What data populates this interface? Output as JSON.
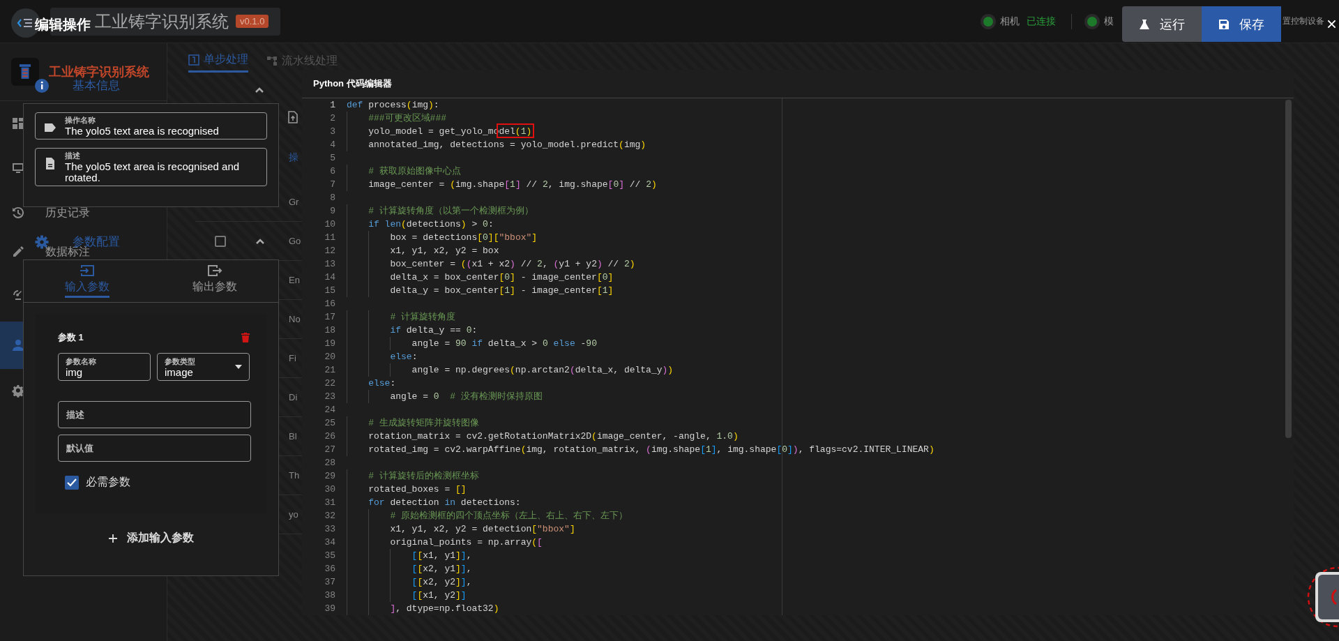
{
  "app": {
    "title": "工业铸字识别系统",
    "version": "v0.1.0"
  },
  "status_items": [
    {
      "label": "相机",
      "value": "已连接",
      "connected": true
    },
    {
      "label": "模",
      "connected": true
    }
  ],
  "partial_label": "置控制设备",
  "sidebar": {
    "brand": "工业铸字识别系统",
    "items": [
      {
        "selected": false
      },
      {
        "selected": false
      },
      {
        "label": "历史记录",
        "selected": false
      },
      {
        "label": "数据标注",
        "selected": false
      },
      {
        "selected": false
      },
      {
        "selected": true
      },
      {
        "selected": false
      }
    ]
  },
  "middle": {
    "tabs": [
      {
        "label": "单步处理",
        "selected": true
      },
      {
        "label": "流水线处理",
        "selected": false
      }
    ],
    "header_expanded": true,
    "section_label": "操",
    "operations": [
      {
        "label": "Gr",
        "kind": "item"
      },
      {
        "label": "Go",
        "kind": "group",
        "checked": false,
        "expanded": true
      },
      {
        "label": "En",
        "kind": "item"
      },
      {
        "label": "No",
        "kind": "item"
      },
      {
        "label": "Fi",
        "kind": "item"
      },
      {
        "label": "Di",
        "kind": "item"
      },
      {
        "label": "Bl",
        "kind": "item"
      },
      {
        "label": "Th",
        "kind": "item"
      },
      {
        "label": "yo",
        "kind": "item"
      }
    ]
  },
  "dialog": {
    "title": "编辑操作",
    "actions": [
      {
        "label": "运行",
        "kind": "run"
      },
      {
        "label": "保存",
        "kind": "save"
      }
    ],
    "basic_info": {
      "heading": "基本信息",
      "fields": [
        {
          "label": "操作名称",
          "value": "The yolo5 text area is recognised"
        },
        {
          "label": "描述",
          "value": "The yolo5 text area is recognised and rotated."
        }
      ]
    },
    "param_config": {
      "heading": "参数配置",
      "tabs": [
        {
          "label": "输入参数",
          "selected": true
        },
        {
          "label": "输出参数",
          "selected": false
        }
      ],
      "params": [
        {
          "title": "参数 1",
          "name_label": "参数名称",
          "name": "img",
          "type_label": "参数类型",
          "type": "image",
          "description_placeholder": "描述",
          "default_placeholder": "默认值",
          "required_label": "必需参数",
          "required": true
        }
      ],
      "add_button": "添加输入参数"
    },
    "editor": {
      "title": "Python 代码编辑器",
      "lines": [
        {
          "number": "1",
          "segments": [
            {
              "kind": "keyword",
              "text": "def"
            },
            {
              "kind": "code",
              "text": " process(img):"
            }
          ]
        },
        {
          "number": "2",
          "segments": [
            {
              "kind": "comment",
              "text": "    ###可更改区域###"
            }
          ]
        },
        {
          "number": "3",
          "segments": [
            {
              "kind": "code",
              "text": "    yolo_model = get_yolo_mo"
            },
            {
              "kind": "code",
              "text": "del(1)",
              "marked": true
            }
          ]
        },
        {
          "number": "4",
          "segments": [
            {
              "kind": "code",
              "text": "    annotated_img, detections = yolo_model.predict(img)"
            }
          ]
        },
        {
          "number": "5"
        },
        {
          "number": "6",
          "segments": [
            {
              "kind": "comment",
              "text": "    # 获取原始图像中心点"
            }
          ]
        },
        {
          "number": "7",
          "segments": [
            {
              "kind": "code",
              "text": "    image_center = (img.shape[1] // 2, img.shape[0] // 2)"
            }
          ]
        },
        {
          "number": "8"
        },
        {
          "number": "9",
          "segments": [
            {
              "kind": "comment",
              "text": "    # 计算旋转角度（以第一个检测框为例）"
            }
          ]
        },
        {
          "number": "10",
          "segments": [
            {
              "kind": "keyword",
              "text": "    if "
            },
            {
              "kind": "keyword",
              "text": "len"
            },
            {
              "kind": "code",
              "text": "(detections) > 0:"
            }
          ]
        },
        {
          "number": "11",
          "segments": [
            {
              "kind": "code",
              "text": "        box = detections[0]["
            },
            {
              "kind": "string",
              "text": "\"bbox\""
            },
            {
              "kind": "code",
              "text": "]"
            }
          ]
        },
        {
          "number": "12",
          "segments": [
            {
              "kind": "code",
              "text": "        x1, y1, x2, y2 = box"
            }
          ]
        },
        {
          "number": "13",
          "segments": [
            {
              "kind": "code",
              "text": "        box_center = ((x1 + x2) // 2, (y1 + y2) // 2)"
            }
          ]
        },
        {
          "number": "14",
          "segments": [
            {
              "kind": "code",
              "text": "        delta_x = box_center[0] - image_center[0]"
            }
          ]
        },
        {
          "number": "15",
          "segments": [
            {
              "kind": "code",
              "text": "        delta_y = box_center[1] - image_center[1]"
            }
          ]
        },
        {
          "number": "16"
        },
        {
          "number": "17",
          "segments": [
            {
              "kind": "comment",
              "text": "        # 计算旋转角度"
            }
          ]
        },
        {
          "number": "18",
          "segments": [
            {
              "kind": "keyword",
              "text": "        if"
            },
            {
              "kind": "code",
              "text": " delta_y == 0:"
            }
          ]
        },
        {
          "number": "19",
          "segments": [
            {
              "kind": "code",
              "text": "            angle = 90 "
            },
            {
              "kind": "keyword",
              "text": "if"
            },
            {
              "kind": "code",
              "text": " delta_x > 0 "
            },
            {
              "kind": "keyword",
              "text": "else"
            },
            {
              "kind": "code",
              "text": " -90"
            }
          ]
        },
        {
          "number": "20",
          "segments": [
            {
              "kind": "keyword",
              "text": "        else"
            },
            {
              "kind": "code",
              "text": ":"
            }
          ]
        },
        {
          "number": "21",
          "segments": [
            {
              "kind": "code",
              "text": "            angle = np.degrees(np.arctan2(delta_x, delta_y))"
            }
          ]
        },
        {
          "number": "22",
          "segments": [
            {
              "kind": "keyword",
              "text": "    else"
            },
            {
              "kind": "code",
              "text": ":"
            }
          ]
        },
        {
          "number": "23",
          "segments": [
            {
              "kind": "code",
              "text": "        angle = 0  "
            },
            {
              "kind": "comment",
              "text": "# 没有检测时保持原图"
            }
          ]
        },
        {
          "number": "24"
        },
        {
          "number": "25",
          "segments": [
            {
              "kind": "comment",
              "text": "    # 生成旋转矩阵并旋转图像"
            }
          ]
        },
        {
          "number": "26",
          "segments": [
            {
              "kind": "code",
              "text": "    rotation_matrix = cv2.getRotationMatrix2D(image_center, -angle, 1.0)"
            }
          ]
        },
        {
          "number": "27",
          "segments": [
            {
              "kind": "code",
              "text": "    rotated_img = cv2.warpAffine(img, rotation_matrix, (img.shape[1], img.shape[0]), flags=cv2.INTER_LINEAR)"
            }
          ]
        },
        {
          "number": "28"
        },
        {
          "number": "29",
          "segments": [
            {
              "kind": "comment",
              "text": "    # 计算旋转后的检测框坐标"
            }
          ]
        },
        {
          "number": "30",
          "segments": [
            {
              "kind": "code",
              "text": "    rotated_boxes = []"
            }
          ]
        },
        {
          "number": "31",
          "segments": [
            {
              "kind": "keyword",
              "text": "    for"
            },
            {
              "kind": "code",
              "text": " detection "
            },
            {
              "kind": "keyword",
              "text": "in"
            },
            {
              "kind": "code",
              "text": " detections:"
            }
          ]
        },
        {
          "number": "32",
          "segments": [
            {
              "kind": "comment",
              "text": "        # 原始检测框的四个顶点坐标（左上、右上、右下、左下）"
            }
          ]
        },
        {
          "number": "33",
          "segments": [
            {
              "kind": "code",
              "text": "        x1, y1, x2, y2 = detection["
            },
            {
              "kind": "string",
              "text": "\"bbox\""
            },
            {
              "kind": "code",
              "text": "]"
            }
          ]
        },
        {
          "number": "34",
          "segments": [
            {
              "kind": "code",
              "text": "        original_points = np.array(["
            }
          ]
        },
        {
          "number": "35",
          "segments": [
            {
              "kind": "code",
              "text": "            [[x1, y1]],"
            }
          ]
        },
        {
          "number": "36",
          "segments": [
            {
              "kind": "code",
              "text": "            [[x2, y1]],"
            }
          ]
        },
        {
          "number": "37",
          "segments": [
            {
              "kind": "code",
              "text": "            [[x2, y2]],"
            }
          ]
        },
        {
          "number": "38",
          "segments": [
            {
              "kind": "code",
              "text": "            [[x1, y2]]"
            }
          ]
        },
        {
          "number": "39",
          "segments": [
            {
              "kind": "code",
              "text": "        ], dtype=np.float32)"
            }
          ]
        }
      ]
    }
  }
}
